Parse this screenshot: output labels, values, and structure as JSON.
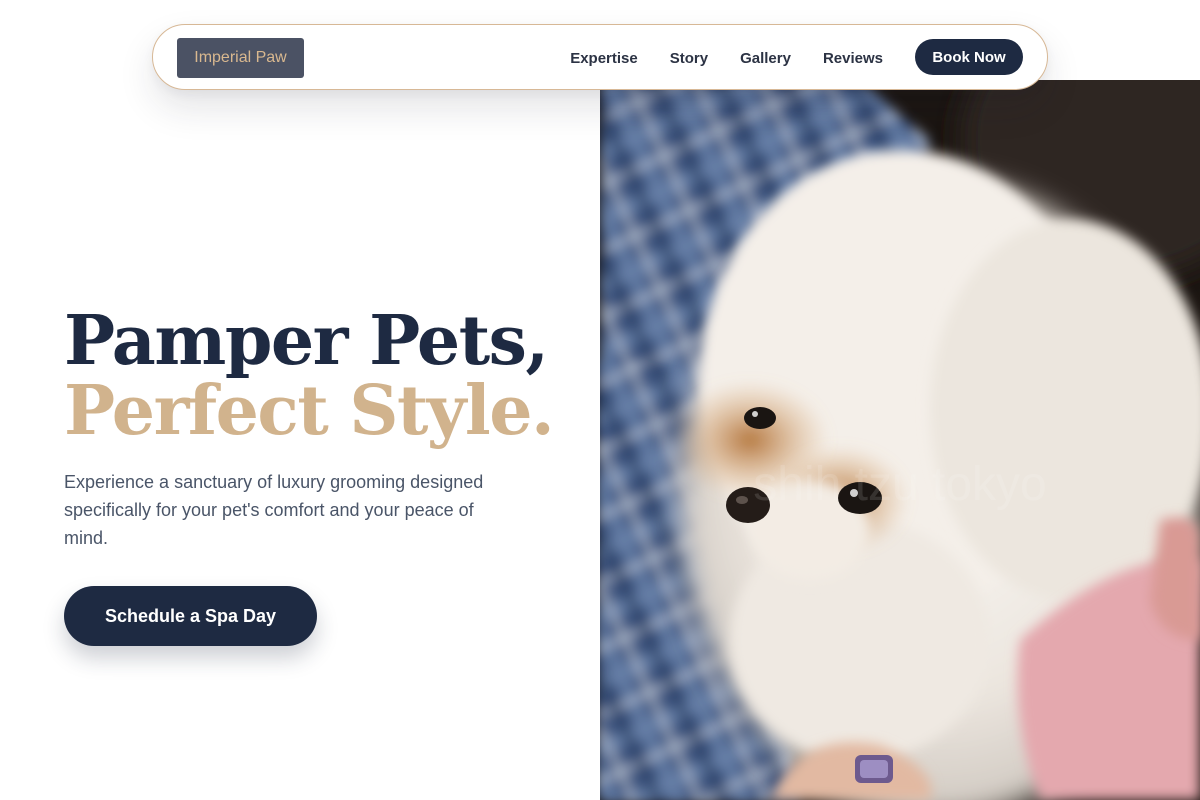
{
  "nav": {
    "logo": "Imperial Paw",
    "links": [
      "Expertise",
      "Story",
      "Gallery",
      "Reviews"
    ],
    "book_button": "Book Now"
  },
  "hero": {
    "headline_line1": "Pamper Pets,",
    "headline_line2": "Perfect Style.",
    "description": "Experience a sanctuary of luxury grooming designed specifically for your pet's comfort and your peace of mind.",
    "cta_button": "Schedule a Spa Day",
    "image_alt": "Fluffy white and tan puppy resting on a blue plaid blanket"
  },
  "colors": {
    "navy": "#1e2a42",
    "gold": "#d1b38d",
    "text_gray": "#4a5568"
  }
}
